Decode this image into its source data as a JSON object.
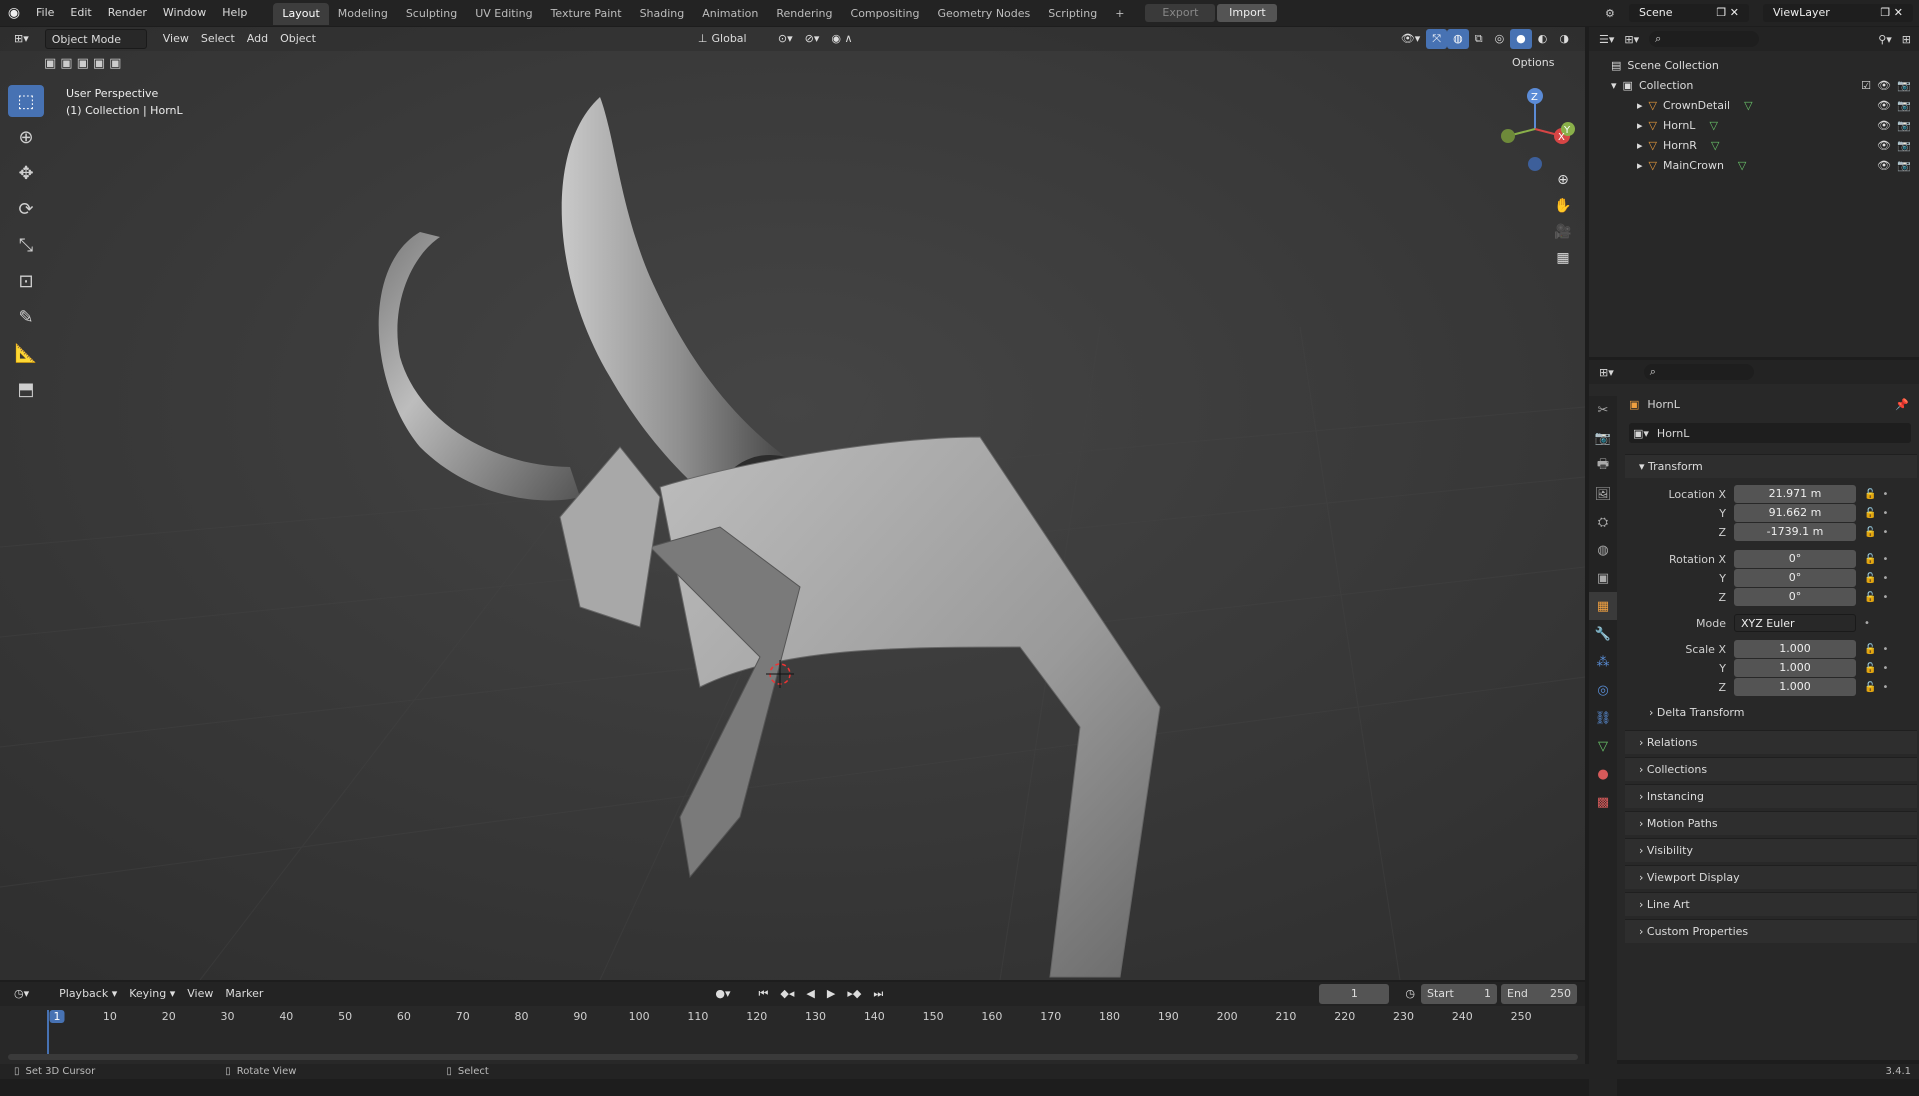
{
  "topbar": {
    "menus": [
      "File",
      "Edit",
      "Render",
      "Window",
      "Help"
    ],
    "workspaces": [
      "Layout",
      "Modeling",
      "Sculpting",
      "UV Editing",
      "Texture Paint",
      "Shading",
      "Animation",
      "Rendering",
      "Compositing",
      "Geometry Nodes",
      "Scripting"
    ],
    "active_workspace": "Layout",
    "add_tab": "+",
    "export_label": "Export",
    "import_label": "Import",
    "scene_label": "Scene",
    "viewlayer_label": "ViewLayer"
  },
  "viewport": {
    "mode": "Object Mode",
    "menus": [
      "View",
      "Select",
      "Add",
      "Object"
    ],
    "transform_orientation": "Global",
    "options_label": "Options",
    "info_line1": "User Perspective",
    "info_line2": "(1) Collection | HornL",
    "gizmo_x": "X",
    "gizmo_y": "Y",
    "gizmo_z": "Z"
  },
  "outliner": {
    "scene_collection": "Scene Collection",
    "collection": "Collection",
    "items": [
      {
        "name": "CrownDetail"
      },
      {
        "name": "HornL"
      },
      {
        "name": "HornR"
      },
      {
        "name": "MainCrown"
      }
    ]
  },
  "properties": {
    "object_name": "HornL",
    "datablock_name": "HornL",
    "transform_label": "Transform",
    "location": {
      "label_x": "Location X",
      "label_y": "Y",
      "label_z": "Z",
      "x": "21.971 m",
      "y": "91.662 m",
      "z": "-1739.1 m"
    },
    "rotation": {
      "label_x": "Rotation X",
      "label_y": "Y",
      "label_z": "Z",
      "x": "0°",
      "y": "0°",
      "z": "0°"
    },
    "mode_label": "Mode",
    "mode_value": "XYZ Euler",
    "scale": {
      "label_x": "Scale X",
      "label_y": "Y",
      "label_z": "Z",
      "x": "1.000",
      "y": "1.000",
      "z": "1.000"
    },
    "delta_transform": "Delta Transform",
    "panels": [
      "Relations",
      "Collections",
      "Instancing",
      "Motion Paths",
      "Visibility",
      "Viewport Display",
      "Line Art",
      "Custom Properties"
    ]
  },
  "timeline": {
    "menus": [
      "Playback",
      "Keying",
      "View",
      "Marker"
    ],
    "current_frame": "1",
    "start_label": "Start",
    "start_value": "1",
    "end_label": "End",
    "end_value": "250",
    "frame_numbers": [
      "1",
      "10",
      "20",
      "30",
      "40",
      "50",
      "60",
      "70",
      "80",
      "90",
      "100",
      "110",
      "120",
      "130",
      "140",
      "150",
      "160",
      "170",
      "180",
      "190",
      "200",
      "210",
      "220",
      "230",
      "240",
      "250"
    ]
  },
  "statusbar": {
    "hint1": "Set 3D Cursor",
    "hint2": "Rotate View",
    "hint3": "Select",
    "version": "3.4.1"
  },
  "colors": {
    "accent": "#4772b3",
    "viewport_bg": "#3b3b3b",
    "panel_bg": "#282828"
  }
}
